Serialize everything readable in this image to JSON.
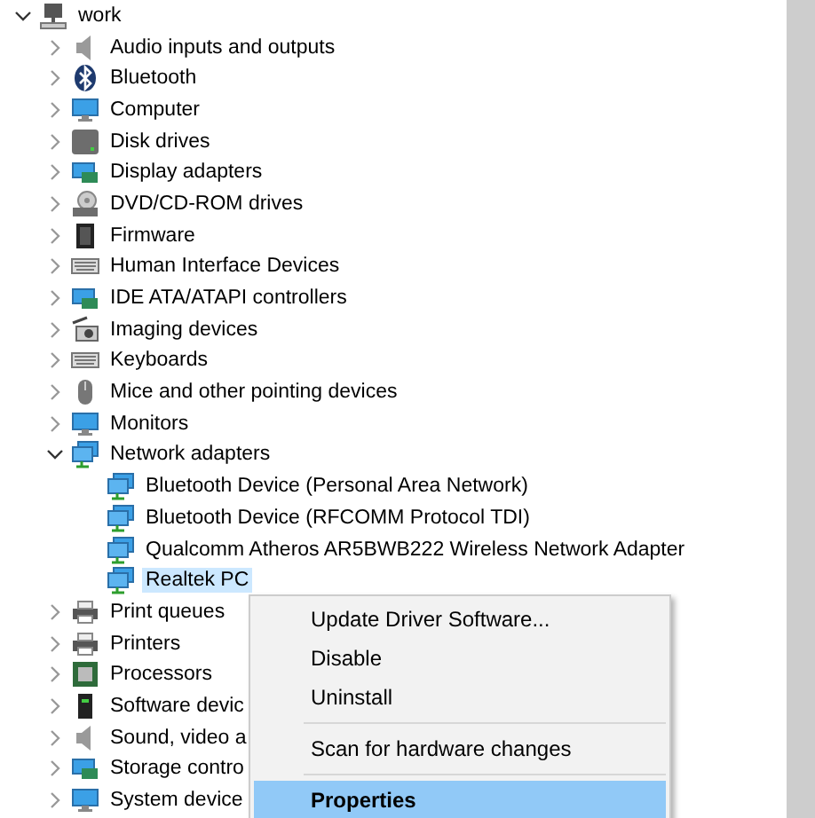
{
  "tree": {
    "label": "work",
    "expanded": true,
    "selected": false,
    "children": [
      {
        "label": "Audio inputs and outputs",
        "expanded": false,
        "selected": false
      },
      {
        "label": "Bluetooth",
        "expanded": false,
        "selected": false
      },
      {
        "label": "Computer",
        "expanded": false,
        "selected": false
      },
      {
        "label": "Disk drives",
        "expanded": false,
        "selected": false
      },
      {
        "label": "Display adapters",
        "expanded": false,
        "selected": false
      },
      {
        "label": "DVD/CD-ROM drives",
        "expanded": false,
        "selected": false
      },
      {
        "label": "Firmware",
        "expanded": false,
        "selected": false
      },
      {
        "label": "Human Interface Devices",
        "expanded": false,
        "selected": false
      },
      {
        "label": "IDE ATA/ATAPI controllers",
        "expanded": false,
        "selected": false
      },
      {
        "label": "Imaging devices",
        "expanded": false,
        "selected": false
      },
      {
        "label": "Keyboards",
        "expanded": false,
        "selected": false
      },
      {
        "label": "Mice and other pointing devices",
        "expanded": false,
        "selected": false
      },
      {
        "label": "Monitors",
        "expanded": false,
        "selected": false
      },
      {
        "label": "Network adapters",
        "expanded": true,
        "selected": false,
        "children": [
          {
            "label": "Bluetooth Device (Personal Area Network)",
            "selected": false
          },
          {
            "label": "Bluetooth Device (RFCOMM Protocol TDI)",
            "selected": false
          },
          {
            "label": "Qualcomm Atheros AR5BWB222 Wireless Network Adapter",
            "selected": false
          },
          {
            "label": "Realtek PC",
            "selected": true
          }
        ]
      },
      {
        "label": "Print queues",
        "expanded": false,
        "selected": false
      },
      {
        "label": "Printers",
        "expanded": false,
        "selected": false
      },
      {
        "label": "Processors",
        "expanded": false,
        "selected": false
      },
      {
        "label": "Software devic",
        "expanded": false,
        "selected": false
      },
      {
        "label": "Sound, video a",
        "expanded": false,
        "selected": false
      },
      {
        "label": "Storage contro",
        "expanded": false,
        "selected": false
      },
      {
        "label": "System device",
        "expanded": false,
        "selected": false
      }
    ]
  },
  "context_menu": {
    "items": [
      {
        "kind": "item",
        "label": "Update Driver Software...",
        "selected": false
      },
      {
        "kind": "item",
        "label": "Disable",
        "selected": false
      },
      {
        "kind": "item",
        "label": "Uninstall",
        "selected": false
      },
      {
        "kind": "separator"
      },
      {
        "kind": "item",
        "label": "Scan for hardware changes",
        "selected": false
      },
      {
        "kind": "separator"
      },
      {
        "kind": "item",
        "label": "Properties",
        "selected": true
      }
    ]
  }
}
